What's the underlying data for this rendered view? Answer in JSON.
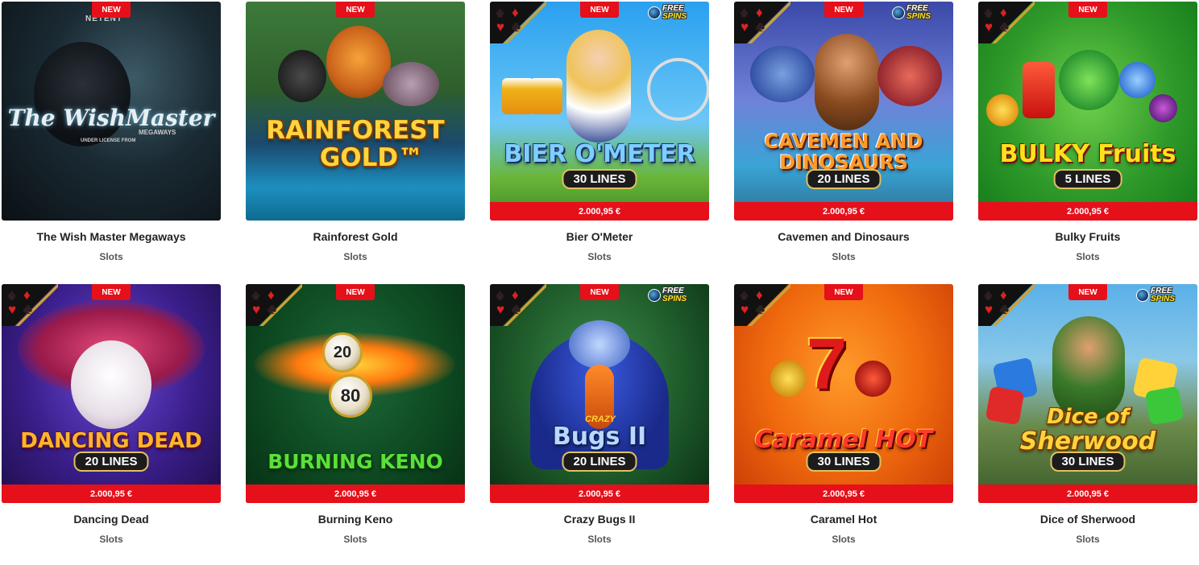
{
  "badges": {
    "new": "NEW",
    "free_spins_line1": "FREE",
    "free_spins_line2": "SPINS"
  },
  "games": [
    {
      "title": "The Wish Master Megaways",
      "category": "Slots",
      "logo": "The WishMaster",
      "logo_sub": "MEGAWAYS",
      "provider": "NETENT",
      "license": "UNDER LICENSE FROM",
      "price": "",
      "lines": ""
    },
    {
      "title": "Rainforest Gold",
      "category": "Slots",
      "logo": "RAINFOREST",
      "logo_sub": "GOLD™",
      "price": "",
      "lines": ""
    },
    {
      "title": "Bier O'Meter",
      "category": "Slots",
      "logo": "BIER O'METER",
      "lines": "30 LINES",
      "price": "2.000,95 €"
    },
    {
      "title": "Cavemen and Dinosaurs",
      "category": "Slots",
      "logo": "CAVEMEN AND",
      "logo_sub": "DINOSAURS",
      "lines": "20 LINES",
      "price": "2.000,95 €"
    },
    {
      "title": "Bulky Fruits",
      "category": "Slots",
      "logo": "BULKY Fruits",
      "lines": "5 LINES",
      "price": "2.000,95 €"
    },
    {
      "title": "Dancing Dead",
      "category": "Slots",
      "logo": "DANCING DEAD",
      "lines": "20 LINES",
      "price": "2.000,95 €"
    },
    {
      "title": "Burning Keno",
      "category": "Slots",
      "logo": "BURNING KENO",
      "ball1": "20",
      "ball2": "80",
      "price": "2.000,95 €"
    },
    {
      "title": "Crazy Bugs II",
      "category": "Slots",
      "logo_small": "CRAZY",
      "logo": "Bugs II",
      "lines": "20 LINES",
      "price": "2.000,95 €"
    },
    {
      "title": "Caramel Hot",
      "category": "Slots",
      "logo_big": "7",
      "logo": "Caramel HOT",
      "lines": "30 LINES",
      "price": "2.000,95 €"
    },
    {
      "title": "Dice of Sherwood",
      "category": "Slots",
      "logo": "Dice of",
      "logo_sub": "Sherwood",
      "lines": "30 LINES",
      "price": "2.000,95 €"
    }
  ],
  "colors": {
    "accent_red": "#e5101a",
    "logo_gold": "#ffd43c"
  },
  "icons": [
    "spade-suit-icon",
    "heart-suit-icon",
    "diamond-suit-icon",
    "club-suit-icon",
    "free-spins-icon"
  ]
}
